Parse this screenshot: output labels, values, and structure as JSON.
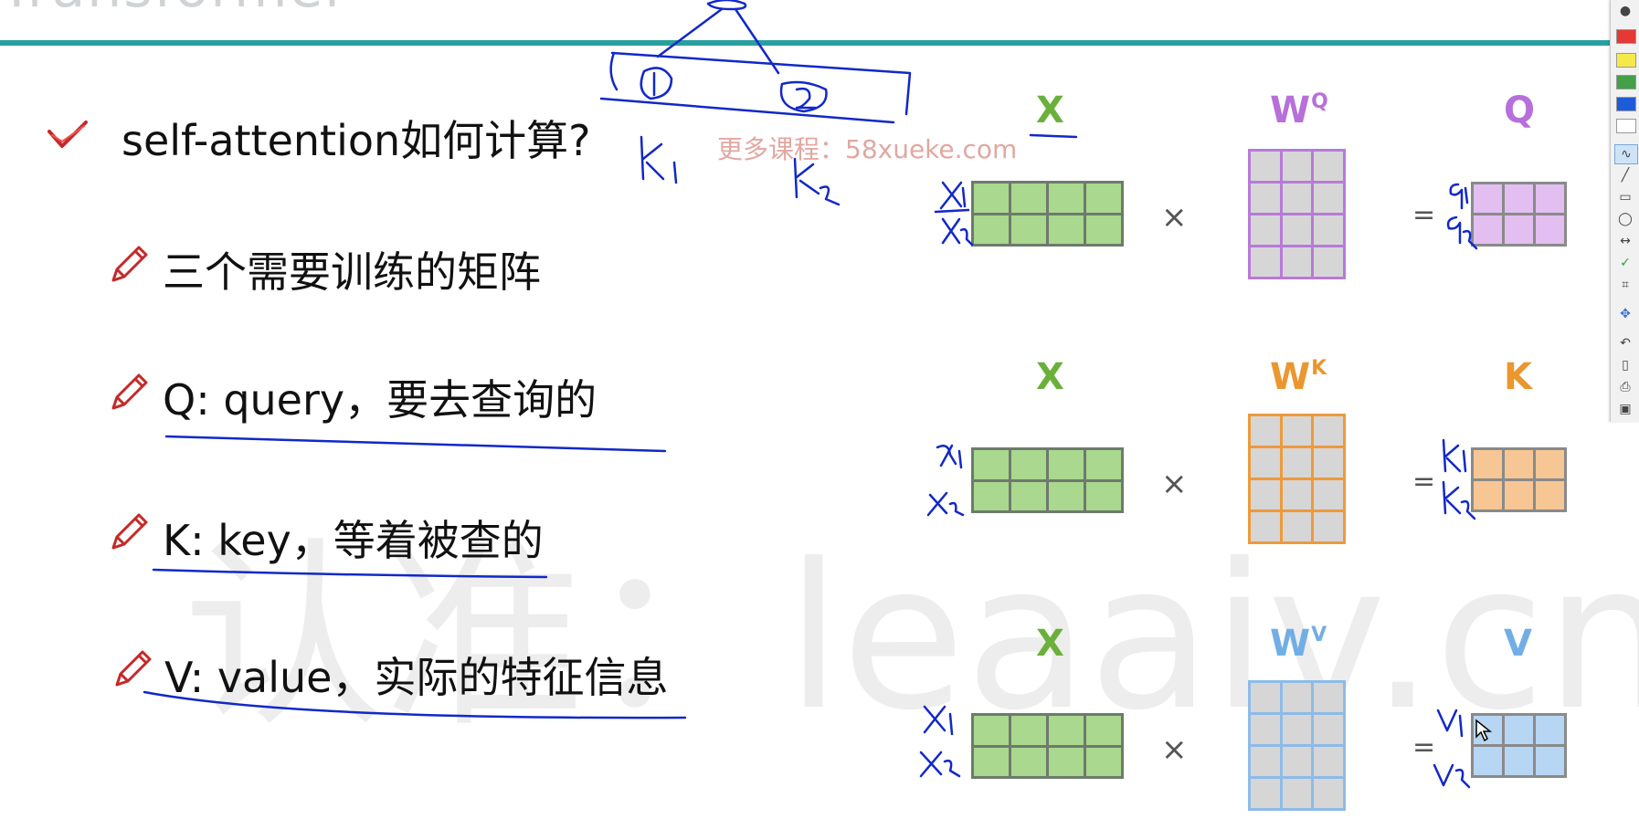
{
  "header": {
    "title_fragment": "Transformer"
  },
  "question": "self-attention如何计算?",
  "bullets": [
    "三个需要训练的矩阵",
    "Q: query，要去查询的",
    "K: key，等着被查的",
    "V: value，实际的特征信息"
  ],
  "watermarks": {
    "main": "认准：leaaiv.cn",
    "source": "更多课程：58xueke.com"
  },
  "matrices": {
    "rows": [
      {
        "input": "X",
        "weight": "W",
        "weight_sup": "Q",
        "output": "Q",
        "op": "×",
        "eq": "="
      },
      {
        "input": "X",
        "weight": "W",
        "weight_sup": "K",
        "output": "K",
        "op": "×",
        "eq": "="
      },
      {
        "input": "X",
        "weight": "W",
        "weight_sup": "V",
        "output": "V",
        "op": "×",
        "eq": "="
      }
    ]
  },
  "annotations": {
    "row1_left": [
      "x1",
      "x2"
    ],
    "row1_right": [
      "q1",
      "q2"
    ],
    "row2_left": [
      "x1",
      "x2"
    ],
    "row2_right": [
      "k1",
      "k2"
    ],
    "row3_left": [
      "x1",
      "x2"
    ],
    "row3_right": [
      "v1",
      "v2"
    ],
    "top": [
      "k1",
      "k2"
    ]
  },
  "toolbar": {
    "colors": [
      "#e53935",
      "#f5e94a",
      "#43a047",
      "#1e5bd8",
      "#ffffff"
    ],
    "tools": [
      "pen-icon",
      "line-icon",
      "rectangle-icon",
      "ellipse-icon",
      "double-arrow-icon",
      "check-icon",
      "crop-icon",
      "move-icon",
      "undo-icon",
      "new-page-icon",
      "print-icon",
      "image-icon"
    ]
  }
}
